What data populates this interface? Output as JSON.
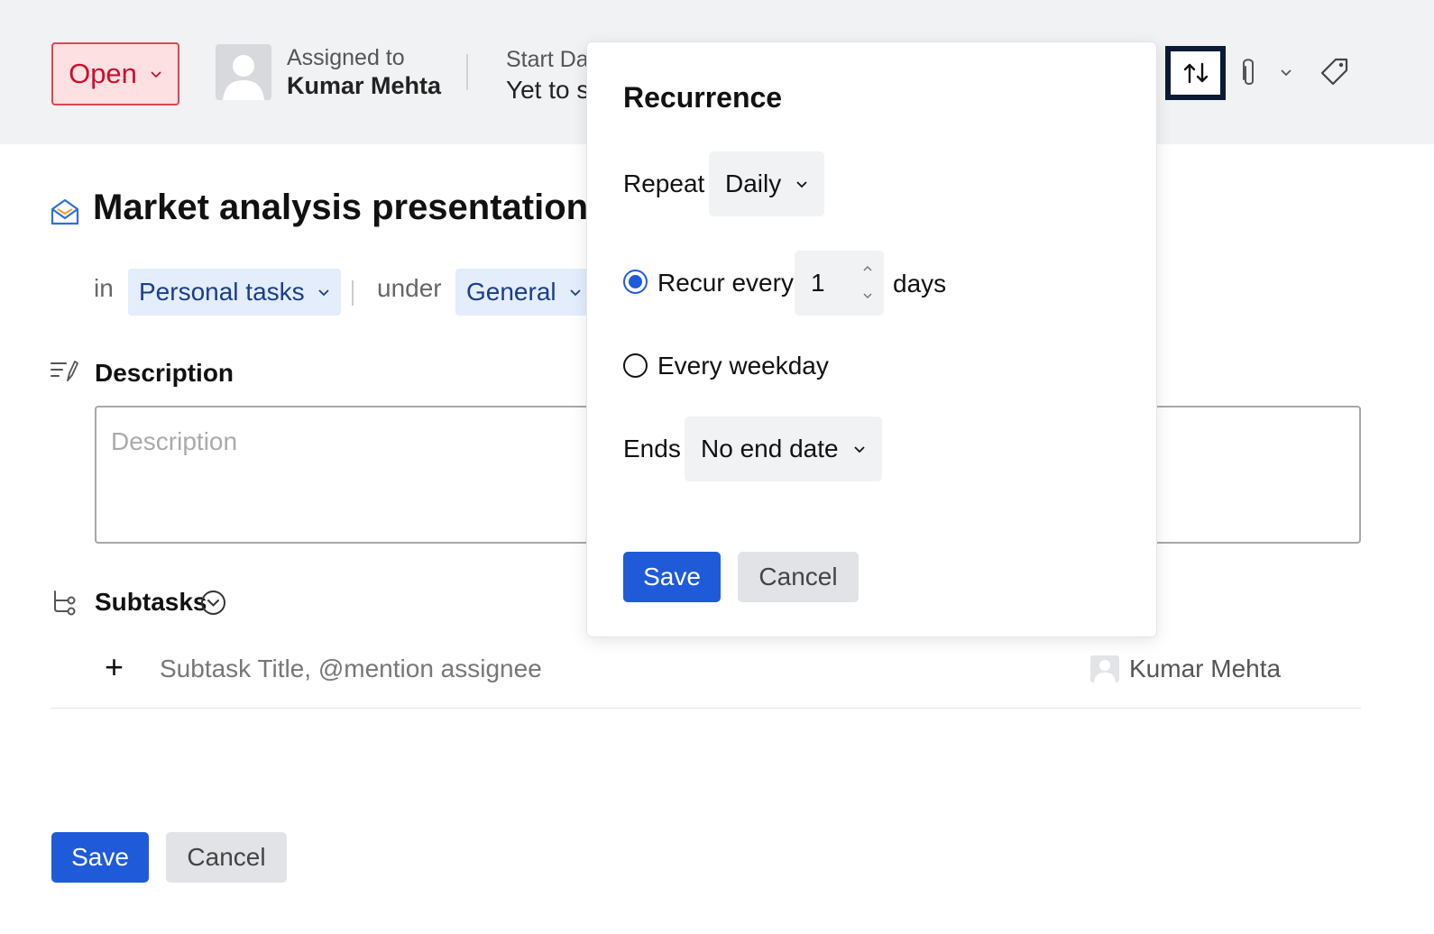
{
  "header": {
    "status_label": "Open",
    "assigned_label": "Assigned to",
    "assigned_name": "Kumar Mehta",
    "start_label": "Start Dat",
    "start_value": "Yet to s"
  },
  "icons": {
    "recurrence": "recurrence-icon",
    "attachment": "paperclip-icon",
    "tag": "tag-icon"
  },
  "task": {
    "title": "Market analysis presentation",
    "in_label": "in",
    "list_name": "Personal tasks",
    "under_label": "under",
    "section_name": "General"
  },
  "description": {
    "heading": "Description",
    "placeholder": "Description"
  },
  "subtasks": {
    "heading": "Subtasks",
    "input_placeholder": "Subtask Title, @mention assignee",
    "assignee": "Kumar Mehta"
  },
  "footer": {
    "save_label": "Save",
    "cancel_label": "Cancel"
  },
  "recurrence": {
    "title": "Recurrence",
    "repeat_label": "Repeat",
    "repeat_value": "Daily",
    "recur_every_label": "Recur every",
    "recur_every_value": "1",
    "recur_every_unit": "days",
    "every_weekday_label": "Every weekday",
    "selected_option": "Recur every",
    "ends_label": "Ends",
    "ends_value": "No end date",
    "save_label": "Save",
    "cancel_label": "Cancel"
  },
  "colors": {
    "primary": "#1f5bd8",
    "status_text": "#c8102e",
    "status_bg": "#fde0e2",
    "chip_bg": "#e3edfb",
    "chip_text": "#1a3e8c"
  }
}
